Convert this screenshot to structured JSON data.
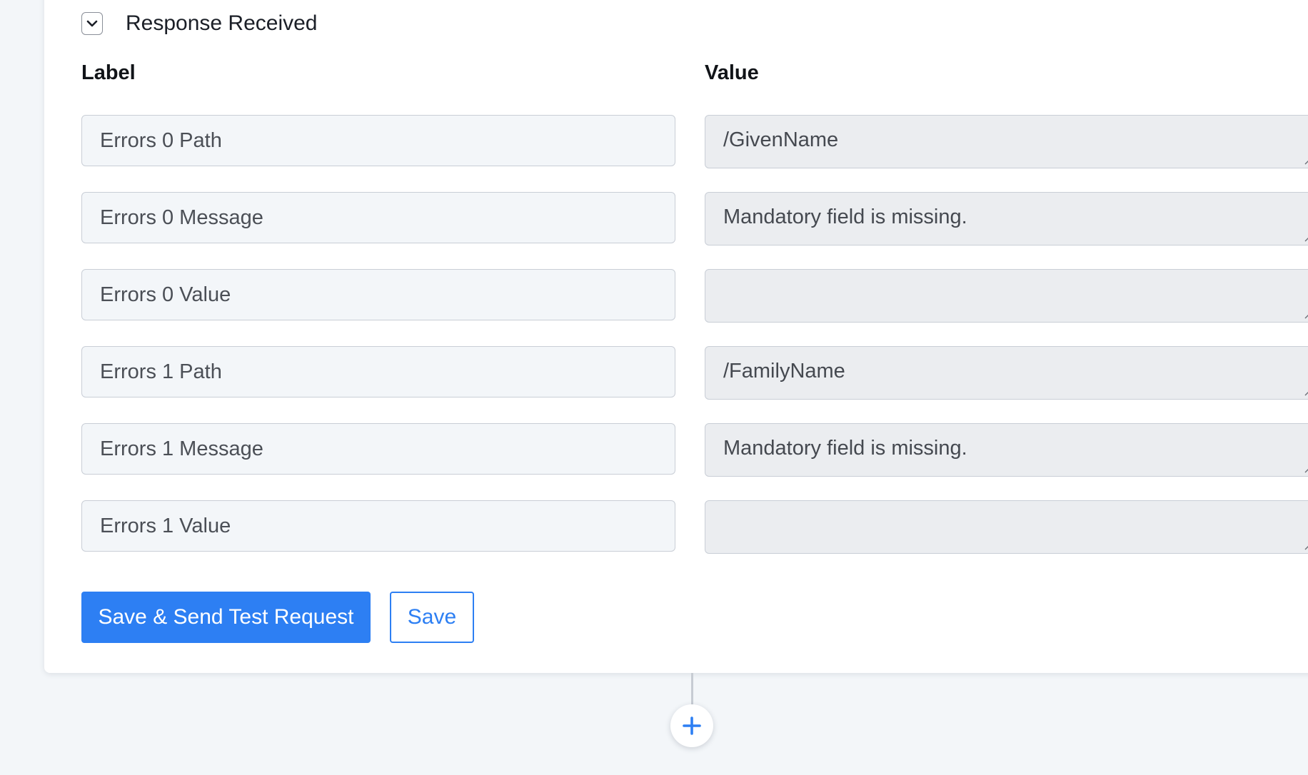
{
  "section": {
    "title": "Response Received",
    "toggle_icon": "chevron-down-icon"
  },
  "columns": {
    "label": "Label",
    "value": "Value"
  },
  "rows": [
    {
      "label": "Errors 0 Path",
      "value": "/GivenName"
    },
    {
      "label": "Errors 0 Message",
      "value": "Mandatory field is missing."
    },
    {
      "label": "Errors 0 Value",
      "value": ""
    },
    {
      "label": "Errors 1 Path",
      "value": "/FamilyName"
    },
    {
      "label": "Errors 1 Message",
      "value": "Mandatory field is missing."
    },
    {
      "label": "Errors 1 Value",
      "value": ""
    }
  ],
  "actions": {
    "primary_label": "Save & Send Test Request",
    "secondary_label": "Save"
  },
  "add_step_icon": "plus-icon",
  "colors": {
    "accent": "#2d7ff3",
    "page_background": "#f3f6f9",
    "label_field_bg": "#f3f6f9",
    "value_field_bg": "#ebedf0",
    "border": "#c9ced6"
  }
}
